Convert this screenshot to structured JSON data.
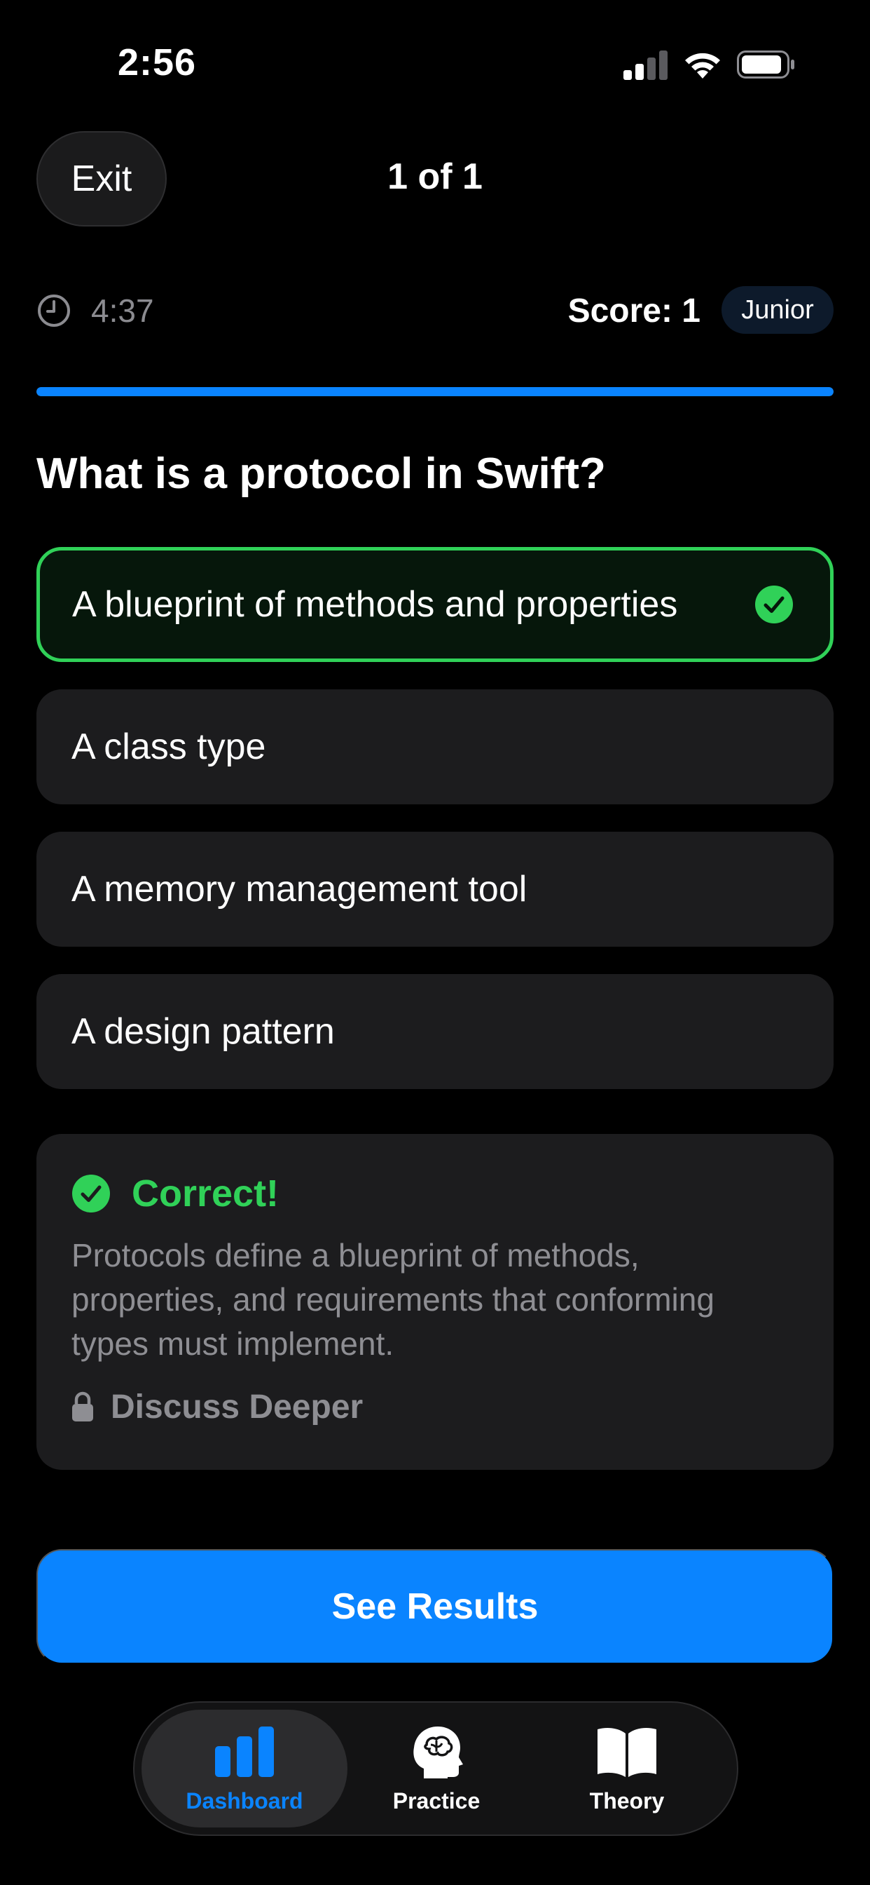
{
  "status_bar": {
    "time": "2:56",
    "icons": [
      "signal-icon",
      "wifi-icon",
      "battery-icon"
    ]
  },
  "header": {
    "exit_label": "Exit",
    "progress_label": "1 of 1"
  },
  "stats": {
    "timer": "4:37",
    "score": "Score: 1",
    "level": "Junior"
  },
  "progress": {
    "fraction": 1.0
  },
  "question": "What is a protocol in Swift?",
  "options": [
    {
      "label": "A blueprint of methods and properties",
      "state": "correct"
    },
    {
      "label": "A class type",
      "state": "default"
    },
    {
      "label": "A memory management tool",
      "state": "default"
    },
    {
      "label": "A design pattern",
      "state": "default"
    }
  ],
  "feedback": {
    "title": "Correct!",
    "explanation": "Protocols define a blueprint of methods, properties, and requirements that conforming types must implement.",
    "discuss_label": "Discuss Deeper"
  },
  "primary_action": "See Results",
  "tabs": [
    {
      "label": "Dashboard",
      "icon": "chart-bar-icon",
      "active": true
    },
    {
      "label": "Practice",
      "icon": "brain-head-icon",
      "active": false
    },
    {
      "label": "Theory",
      "icon": "book-icon",
      "active": false
    }
  ],
  "colors": {
    "accent": "#0a84ff",
    "success": "#30d158",
    "card": "#1c1c1e",
    "background": "#000000"
  }
}
